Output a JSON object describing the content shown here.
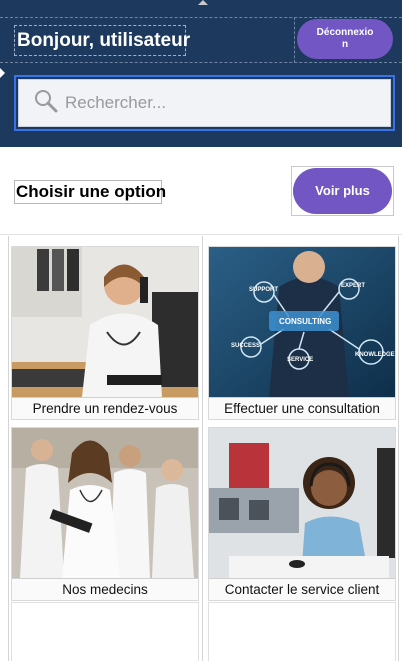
{
  "header": {
    "greeting": "Bonjour, utilisateur",
    "logout_label": "Déconnexion",
    "background_color": "#1d3a5e"
  },
  "search": {
    "placeholder": "Rechercher...",
    "icon": "search-icon"
  },
  "section": {
    "title": "Choisir une option",
    "more_label": "Voir plus"
  },
  "accent_color": "#7256c4",
  "options": [
    {
      "label": "Prendre un rendez-vous",
      "image": "doctor-on-phone-photo"
    },
    {
      "label": "Effectuer une consultation",
      "image": "consulting-diagram-photo"
    },
    {
      "label": "Nos medecins",
      "image": "medical-team-photo"
    },
    {
      "label": "Contacter le service client",
      "image": "call-center-agent-photo"
    }
  ]
}
